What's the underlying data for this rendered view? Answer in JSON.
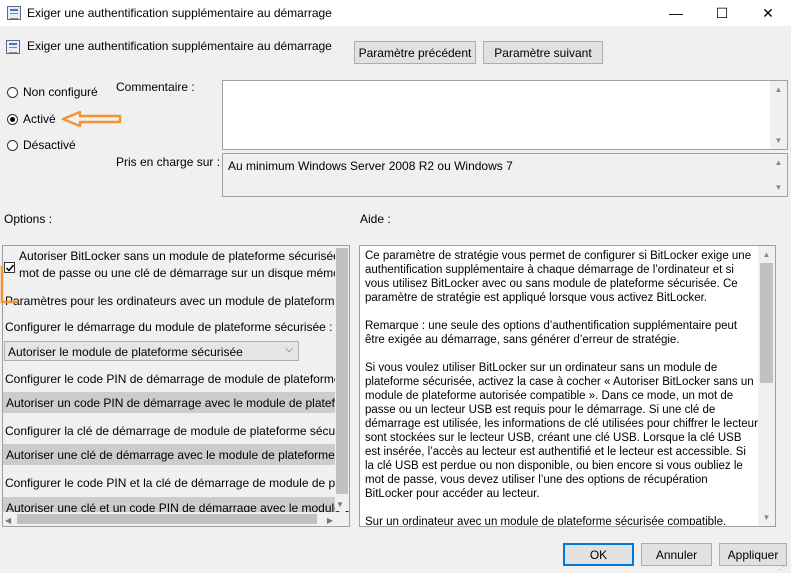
{
  "window": {
    "title": "Exiger une authentification supplémentaire au démarrage",
    "minimize_glyph": "—",
    "maximize_glyph": "☐",
    "close_glyph": "✕"
  },
  "header": {
    "policy_name": "Exiger une authentification supplémentaire au démarrage",
    "prev_button": "Paramètre précédent",
    "next_button": "Paramètre suivant"
  },
  "state": {
    "options": [
      {
        "label": "Non configuré",
        "selected": false
      },
      {
        "label": "Activé",
        "selected": true
      },
      {
        "label": "Désactivé",
        "selected": false
      }
    ]
  },
  "comment": {
    "label": "Commentaire :",
    "value": ""
  },
  "supported": {
    "label": "Pris en charge sur :",
    "value": "Au minimum Windows Server 2008 R2 ou Windows 7"
  },
  "options_panel": {
    "label": "Options :",
    "checkbox_label_line1": "Autoriser BitLocker sans un module de plateforme sécurisée compatible (requiert un",
    "checkbox_label_line2": "mot de passe ou une clé de démarrage sur un disque mémoire flash USB)",
    "checkbox_checked": true,
    "tpm_heading": "Paramètres pour les ordinateurs avec un module de plateforme sécurisée :",
    "cfg_tpm_label": "Configurer le démarrage du module de plateforme sécurisée :",
    "cfg_tpm_value": "Autoriser le module de plateforme sécurisée",
    "cfg_pin_label": "Configurer le code PIN de démarrage de module de plateforme sécurisée :",
    "cfg_pin_value": "Autoriser un code PIN de démarrage avec le module de plateforme sécurisée",
    "cfg_key_label": "Configurer la clé de démarrage de module de plateforme sécurisée :",
    "cfg_key_value": "Autoriser une clé de démarrage avec le module de plateforme sécurisée",
    "cfg_keypin_label": "Configurer le code PIN et la clé de démarrage de module de plateforme sécurisée :",
    "cfg_keypin_value": "Autoriser une clé et un code PIN de démarrage avec le module de plateforme sécurisée"
  },
  "help_panel": {
    "label": "Aide :",
    "paragraphs": [
      "Ce paramètre de stratégie vous permet de configurer si BitLocker exige une authentification supplémentaire à chaque démarrage de l’ordinateur et si vous utilisez BitLocker avec ou sans module de plateforme sécurisée. Ce paramètre de stratégie est appliqué lorsque vous activez BitLocker.",
      "Remarque : une seule des options d’authentification supplémentaire peut être exigée au démarrage, sans générer d’erreur de stratégie.",
      "Si vous voulez utiliser BitLocker sur un ordinateur sans un module de plateforme sécurisée, activez la case à cocher « Autoriser BitLocker sans un module de plateforme autorisée compatible ». Dans ce mode, un mot de passe ou un lecteur USB est requis pour le démarrage. Si une clé de démarrage est utilisée, les informations de clé utilisées pour chiffrer le lecteur sont stockées sur le lecteur USB, créant une clé USB. Lorsque la clé USB est insérée, l’accès au lecteur est authentifié et le lecteur est accessible. Si la clé USB est perdue ou non disponible, ou bien encore si vous oubliez le mot de passe, vous devez utiliser l’une des options de récupération BitLocker pour accéder au lecteur.",
      "Sur un ordinateur avec un module de plateforme sécurisée compatible, quatre types de méthode d’authentification peuvent être utilisés au démarrage pour"
    ]
  },
  "footer": {
    "ok": "OK",
    "cancel": "Annuler",
    "apply": "Appliquer"
  },
  "annotation_color": "#f39434"
}
